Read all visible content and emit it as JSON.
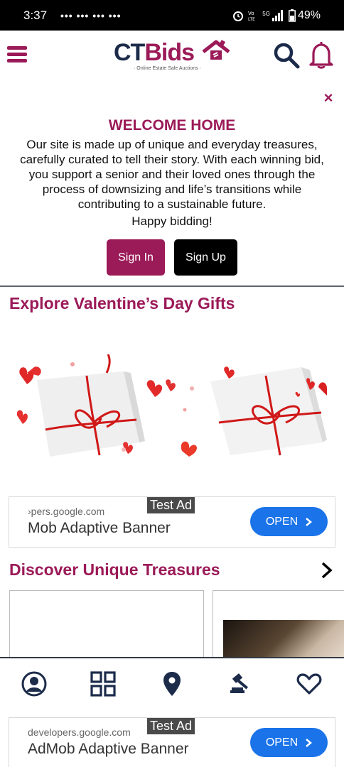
{
  "status_bar": {
    "time": "3:37",
    "notifications": "••• ••• ••• •••",
    "network": "5G",
    "battery": "49%"
  },
  "header": {
    "logo_ct": "CT",
    "logo_bids": "Bids",
    "logo_tagline": "· Online Estate Sale Auctions ·"
  },
  "welcome": {
    "close": "×",
    "title": "WELCOME HOME",
    "body": "Our site is made up of unique and everyday treasures, carefully curated to tell their story. With each winning bid, you support a senior and their loved ones through the process of downsizing and life’s transitions while contributing to a sustainable future.",
    "happy": "Happy bidding!",
    "sign_in": "Sign In",
    "sign_up": "Sign Up"
  },
  "sections": {
    "valentines_title": "Explore Valentine’s Day Gifts",
    "discover_title": "Discover Unique Treasures"
  },
  "ads": {
    "top": {
      "tag": "Test Ad",
      "url": "›pers.google.com",
      "headline": "Mob Adaptive Banner",
      "button": "OPEN"
    },
    "bottom": {
      "tag": "Test Ad",
      "url": "developers.google.com",
      "headline": "AdMob Adaptive Banner",
      "button": "OPEN"
    }
  },
  "bottom_nav": {
    "items": [
      "account-icon",
      "grid-icon",
      "location-icon",
      "gavel-icon",
      "heart-icon"
    ]
  },
  "colors": {
    "brand": "#9b1a58",
    "navy": "#1c2b4a",
    "ad_blue": "#1a73e8"
  }
}
